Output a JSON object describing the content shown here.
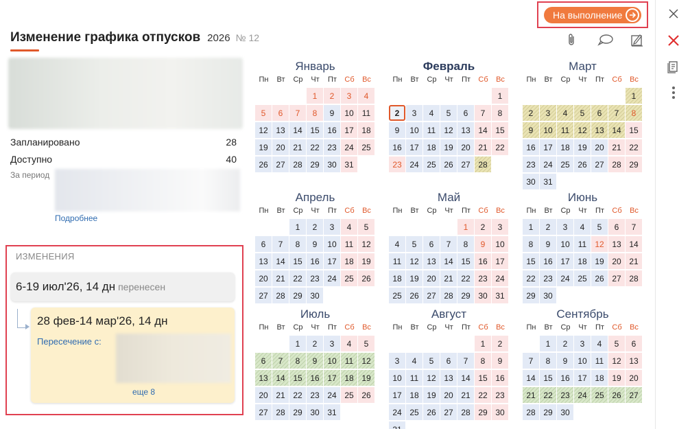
{
  "header": {
    "title": "Изменение графика отпусков",
    "year": "2026",
    "number": "№ 12",
    "exec_button": "На выполнение"
  },
  "icons": {
    "attach": "paperclip-icon",
    "comments": "chat-icon",
    "sign": "signature-icon",
    "close": "close-icon",
    "reject": "reject-icon",
    "doc": "document-icon",
    "menu": "more-vertical-icon"
  },
  "colors": {
    "accent": "#f07a3e",
    "highlight_border": "#e04050",
    "link": "#2f6bb0",
    "weekday_cell": "#e3eaf6",
    "weekend_cell": "#fbe4e4",
    "vacation_cell": "#d8e7c9",
    "planned_cell": "#e9e3b4",
    "change_card": "#fdf0cc"
  },
  "summary": {
    "planned_label": "Запланировано",
    "planned_value": "28",
    "available_label": "Доступно",
    "available_value": "40",
    "period_label": "За период",
    "more_link": "Подробнее"
  },
  "changes": {
    "title": "ИЗМЕНЕНИЯ",
    "old": {
      "range": "6-19 июл'26, 14 дн",
      "status": "перенесен"
    },
    "new": {
      "range": "28 фев-14 мар'26, 14 дн",
      "overlap_label": "Пересечение с:",
      "more": "еще 8"
    }
  },
  "weekdays": [
    "Пн",
    "Вт",
    "Ср",
    "Чт",
    "Пт",
    "Сб",
    "Вс"
  ],
  "months": [
    {
      "name": "Январь",
      "offset": 3,
      "days": 31,
      "current": false,
      "holidays": [
        1,
        2,
        3,
        4,
        5,
        6,
        7,
        8
      ],
      "vacation": [],
      "planned": []
    },
    {
      "name": "Февраль",
      "offset": 6,
      "days": 28,
      "current": true,
      "today": 2,
      "holidays": [
        23
      ],
      "vacation": [],
      "planned": [
        28
      ]
    },
    {
      "name": "Март",
      "offset": 6,
      "days": 31,
      "current": false,
      "holidays": [
        8
      ],
      "vacation": [],
      "planned": [
        1,
        2,
        3,
        4,
        5,
        6,
        7,
        8,
        9,
        10,
        11,
        12,
        13,
        14
      ]
    },
    {
      "name": "Апрель",
      "offset": 2,
      "days": 30,
      "current": false,
      "holidays": [],
      "vacation": [],
      "planned": []
    },
    {
      "name": "Май",
      "offset": 4,
      "days": 31,
      "current": false,
      "holidays": [
        1,
        9
      ],
      "vacation": [],
      "planned": []
    },
    {
      "name": "Июнь",
      "offset": 0,
      "days": 30,
      "current": false,
      "holidays": [
        12
      ],
      "vacation": [],
      "planned": []
    },
    {
      "name": "Июль",
      "offset": 2,
      "days": 31,
      "current": false,
      "holidays": [],
      "vacation": [
        6,
        7,
        8,
        9,
        10,
        11,
        12,
        13,
        14,
        15,
        16,
        17,
        18,
        19
      ],
      "planned": []
    },
    {
      "name": "Август",
      "offset": 5,
      "days": 31,
      "current": false,
      "holidays": [],
      "vacation": [],
      "planned": []
    },
    {
      "name": "Сентябрь",
      "offset": 1,
      "days": 30,
      "current": false,
      "holidays": [],
      "vacation": [
        21,
        22,
        23,
        24,
        25,
        26,
        27
      ],
      "planned": []
    }
  ]
}
